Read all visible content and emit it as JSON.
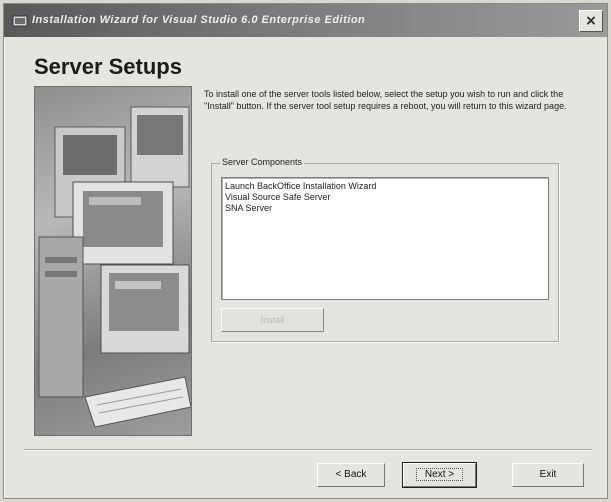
{
  "window": {
    "title": "Installation Wizard for Visual Studio 6.0 Enterprise Edition",
    "close_glyph": "×"
  },
  "page": {
    "title": "Server Setups",
    "description": "To install one of the server tools listed below, select the setup you wish to run and click the \"Install\" button. If the server tool setup requires a reboot, you will return to this wizard page."
  },
  "server_components": {
    "label": "Server Components",
    "items": [
      "Launch BackOffice Installation Wizard",
      "Visual Source Safe Server",
      "SNA Server"
    ],
    "install_label": "Install"
  },
  "buttons": {
    "back_label": "< Back",
    "next_label": "Next >",
    "exit_label": "Exit"
  },
  "colors": {
    "titlebar": "#6b6b6b",
    "dialog_bg": "#e6e4de"
  }
}
